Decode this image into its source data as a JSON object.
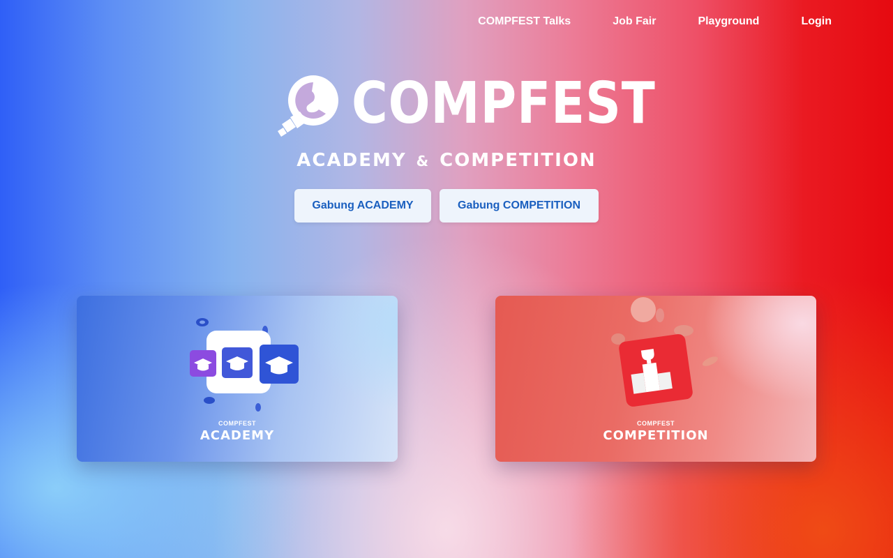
{
  "nav": {
    "items": [
      {
        "label": "COMPFEST Talks"
      },
      {
        "label": "Job Fair"
      },
      {
        "label": "Playground"
      },
      {
        "label": "Login"
      }
    ]
  },
  "hero": {
    "logo_text": "COMPFEST",
    "subtitle_left": "ACADEMY",
    "subtitle_amp": "&",
    "subtitle_right": "COMPETITION",
    "buttons": [
      {
        "label": "Gabung ACADEMY"
      },
      {
        "label": "Gabung COMPETITION"
      }
    ]
  },
  "cards": [
    {
      "brand": "COMPFEST",
      "title": "ACADEMY",
      "icon": "graduation-cap-icon"
    },
    {
      "brand": "COMPFEST",
      "title": "COMPETITION",
      "icon": "trophy-podium-icon"
    }
  ],
  "colors": {
    "accent_blue": "#2f5ff7",
    "accent_red": "#e60a10",
    "button_text": "#1a5fbf",
    "button_bg": "#eef4fc"
  }
}
